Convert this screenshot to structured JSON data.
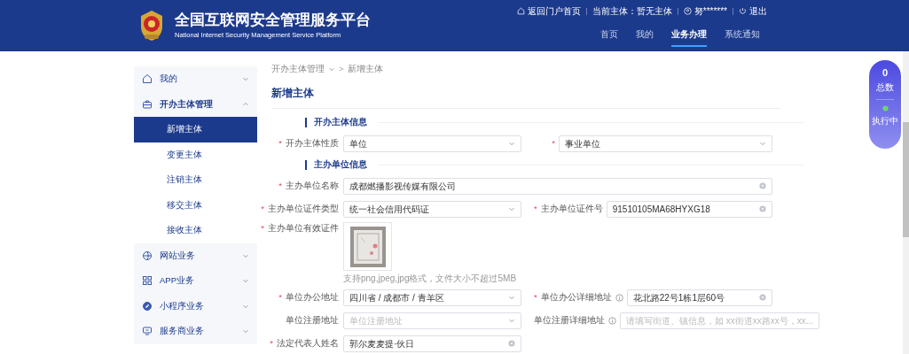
{
  "header": {
    "title": "全国互联网安全管理服务平台",
    "subtitle": "National Internet Security Management Service Platform",
    "top_links": [
      {
        "kind": "home",
        "label": "返回门户首页"
      },
      {
        "kind": "text",
        "label": "当前主体：暂无主体"
      },
      {
        "kind": "user",
        "label": "努*******"
      },
      {
        "kind": "logout",
        "label": "退出"
      }
    ],
    "nav": [
      {
        "label": "首页",
        "selected": false
      },
      {
        "label": "我的",
        "selected": false
      },
      {
        "label": "业务办理",
        "selected": true
      },
      {
        "label": "系统通知",
        "selected": false
      }
    ]
  },
  "sidebar": {
    "items": [
      {
        "kind": "home",
        "label": "我的",
        "expanded": false
      },
      {
        "kind": "briefcase",
        "label": "开办主体管理",
        "expanded": true,
        "children": [
          {
            "label": "新增主体",
            "selected": true
          },
          {
            "label": "变更主体",
            "selected": false
          },
          {
            "label": "注销主体",
            "selected": false
          },
          {
            "label": "移交主体",
            "selected": false
          },
          {
            "label": "接收主体",
            "selected": false
          }
        ]
      },
      {
        "kind": "globe",
        "label": "网站业务",
        "expanded": false
      },
      {
        "kind": "grid",
        "label": "APP业务",
        "expanded": false
      },
      {
        "kind": "compass",
        "label": "小程序业务",
        "expanded": false
      },
      {
        "kind": "monitor",
        "label": "服务商业务",
        "expanded": false
      }
    ]
  },
  "breadcrumb": {
    "items": [
      "开办主体管理",
      "新增主体"
    ],
    "separator": ">"
  },
  "page_title": "新增主体",
  "form": [
    {
      "kind": "section",
      "title": "开办主体信息"
    },
    {
      "kind": "fields",
      "fields": [
        {
          "label": "开办主体性质",
          "marker": "*",
          "kind": "select",
          "value": "单位"
        },
        {
          "marker": "*",
          "kind": "select",
          "value": "事业单位"
        }
      ]
    },
    {
      "kind": "section",
      "title": "主办单位信息"
    },
    {
      "kind": "fields",
      "fields": [
        {
          "label": "主办单位名称",
          "marker": "*",
          "kind": "input",
          "wide": true,
          "value": "成都燃播影视传媒有限公司"
        }
      ]
    },
    {
      "kind": "fields",
      "fields": [
        {
          "label": "主办单位证件类型",
          "marker": "*",
          "kind": "select",
          "value": "统一社会信用代码证"
        },
        {
          "label": "主办单位证件号",
          "marker": "*",
          "kind": "input",
          "value": "91510105MA68HYXG18"
        }
      ]
    },
    {
      "kind": "upload",
      "label": "主办单位有效证件",
      "marker": "*",
      "hint": "支持png,jpeg,jpg格式，文件大小不超过5MB"
    },
    {
      "kind": "fields",
      "fields": [
        {
          "label": "单位办公地址",
          "marker": "*",
          "kind": "select",
          "value": "四川省 / 成都市 / 青羊区"
        },
        {
          "label": "单位办公详细地址",
          "marker": "*",
          "info": true,
          "kind": "input",
          "value": "花北路22号1栋1层60号"
        }
      ]
    },
    {
      "kind": "fields",
      "fields": [
        {
          "label": "单位注册地址",
          "kind": "select",
          "placeholder": "单位注册地址"
        },
        {
          "label": "单位注册详细地址",
          "info": true,
          "kind": "input",
          "placeholder": "请填写街道、镇信息，如 xx街道xx路xx号，xx..."
        }
      ]
    },
    {
      "kind": "fields",
      "fields": [
        {
          "label": "法定代表人姓名",
          "marker": "*",
          "kind": "input",
          "value": "郭尔麦麦提·伙日"
        }
      ]
    }
  ],
  "task_widget": {
    "count": "0",
    "count_label": "总数",
    "running_label": "执行中"
  }
}
